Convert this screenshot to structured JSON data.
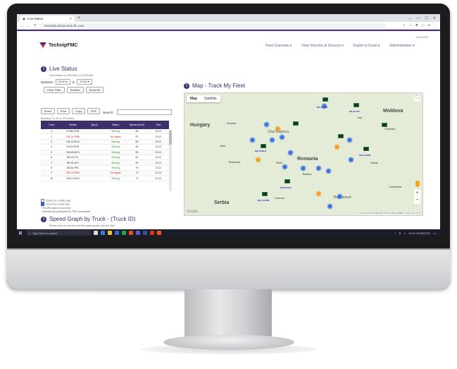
{
  "browser": {
    "tab_title": "Live Status",
    "url": "senergtruckeye.tank-tfc.com"
  },
  "header": {
    "brand": "TechnipFMC",
    "logout": "LOG OUT",
    "nav": [
      "Fleet Overview ▾",
      "View Volumes & Sensors ▾",
      "Export to Excel ▾",
      "Administration ▾"
    ]
  },
  "live_status": {
    "number": "1",
    "title": "Live Status",
    "last_refresh": "Last refresh on 9/30/2022, 13:19:03 ###",
    "between_label": "Between",
    "time_from": "00:00 ▾",
    "time_to": "23:59 ▾",
    "buttons1": [
      "Clear Filter",
      "Refresh",
      "Show All"
    ],
    "buttons2": [
      "Excel",
      "Print",
      "Copy",
      "PDF"
    ],
    "search_label": "Search:",
    "showing": "Showing 1 to 25 of 125 entries",
    "columns": [
      "S.No",
      "Vehicle",
      "Qty (t)",
      "Status",
      "Speed (km/h)",
      "Time"
    ],
    "rows": [
      [
        "1",
        "B-382-XUR",
        "",
        "Moving",
        "80",
        "13:12"
      ],
      [
        "2",
        "DB-14-SPM",
        "",
        "No signal",
        "87",
        "13:12"
      ],
      [
        "3",
        "DB-10-MLN",
        "",
        "Moving",
        "66",
        "13:12"
      ],
      [
        "4",
        "B-512-EUR",
        "",
        "Moving",
        "66",
        "13:12"
      ],
      [
        "5",
        "DB-48-MLN",
        "",
        "Moving",
        "53",
        "13:14"
      ],
      [
        "6",
        "DB-03-STL",
        "",
        "Moving",
        "61",
        "13:12"
      ],
      [
        "7",
        "DB-30-ATC",
        "",
        "Moving",
        "55",
        "13:12"
      ],
      [
        "8",
        "DB-84-PEL",
        "",
        "Moving",
        "78",
        "13:12"
      ],
      [
        "9",
        "DB-19-SPM",
        "",
        "No signal",
        "73",
        "13:12"
      ],
      [
        "10",
        "DB-20-MLN",
        "",
        "Moving",
        "72",
        "13:12"
      ]
    ],
    "checks": [
      "Check for a traffic map",
      "Check for a road map",
      "* 25 DRS (also a hour Exit)",
      "* Vehicles are positioned by GPS coordinates"
    ]
  },
  "map": {
    "number": "2",
    "title": "Map - Track My Fleet",
    "tabs": [
      "Map",
      "Satellite"
    ],
    "countries": [
      "Hungary",
      "Romania",
      "Serbia",
      "Moldova"
    ],
    "cities": [
      "Cluj-Napoca",
      "Timișoara",
      "Bucharest",
      "Brașov",
      "Iași",
      "Craiova",
      "Sibiu",
      "Chișinău",
      "Arad",
      "Oradea",
      "Constanța",
      "Galați"
    ],
    "tags": [
      "DB-31-ATC",
      "DB-57-STL",
      "DB-08-MLN",
      "SM-38-DLK",
      "DB-50-SPM",
      "DB-14-SPM"
    ],
    "google": "Google",
    "attribution": "Keyboard shortcuts  Map data ©2022 GeoBasis-DE/BKG, Google  Terms of Use"
  },
  "speed_graph": {
    "number": "3",
    "title": "Speed Graph by Truck - (Truck ID)",
    "hint": "Please click on a truck to see the speed graph over the shift"
  },
  "taskbar": {
    "search_placeholder": "Type here to search",
    "time": "13:21",
    "date": "30/09/2022"
  },
  "colors": {
    "brand_purple": "#3d2f6b",
    "moving": "#2a8a2a",
    "no_signal": "#d02020"
  }
}
